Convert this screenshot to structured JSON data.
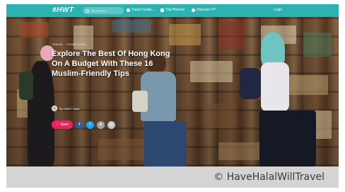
{
  "nav": {
    "logo": "#HWT",
    "search_placeholder": "SEARCH",
    "links": [
      {
        "label": "Travel Guide ⌄",
        "icon": "globe-icon"
      },
      {
        "label": "Trip Planner",
        "icon": "folder-icon"
      },
      {
        "label": "Discover HT",
        "icon": "compass-icon"
      }
    ],
    "login": "Login",
    "bg_color": "#2ab3b1"
  },
  "article": {
    "kicker": "TRAVEL · HONG KONG",
    "title": "Explore The Best Of Hong Kong On A Budget With These 16 Muslim-Friendly Tips",
    "author": "By HHWT Team",
    "save_label": "Save",
    "share": [
      {
        "icon": "facebook-icon",
        "glyph": "f",
        "color": "#3b5998"
      },
      {
        "icon": "twitter-icon",
        "glyph": "t",
        "color": "#1da1f2"
      },
      {
        "icon": "whatsapp-icon",
        "glyph": "w",
        "color": "#9aa3ad"
      },
      {
        "icon": "email-icon",
        "glyph": "@",
        "color": "#c4c4c4"
      }
    ]
  },
  "caption": "© HaveHalalWillTravel"
}
